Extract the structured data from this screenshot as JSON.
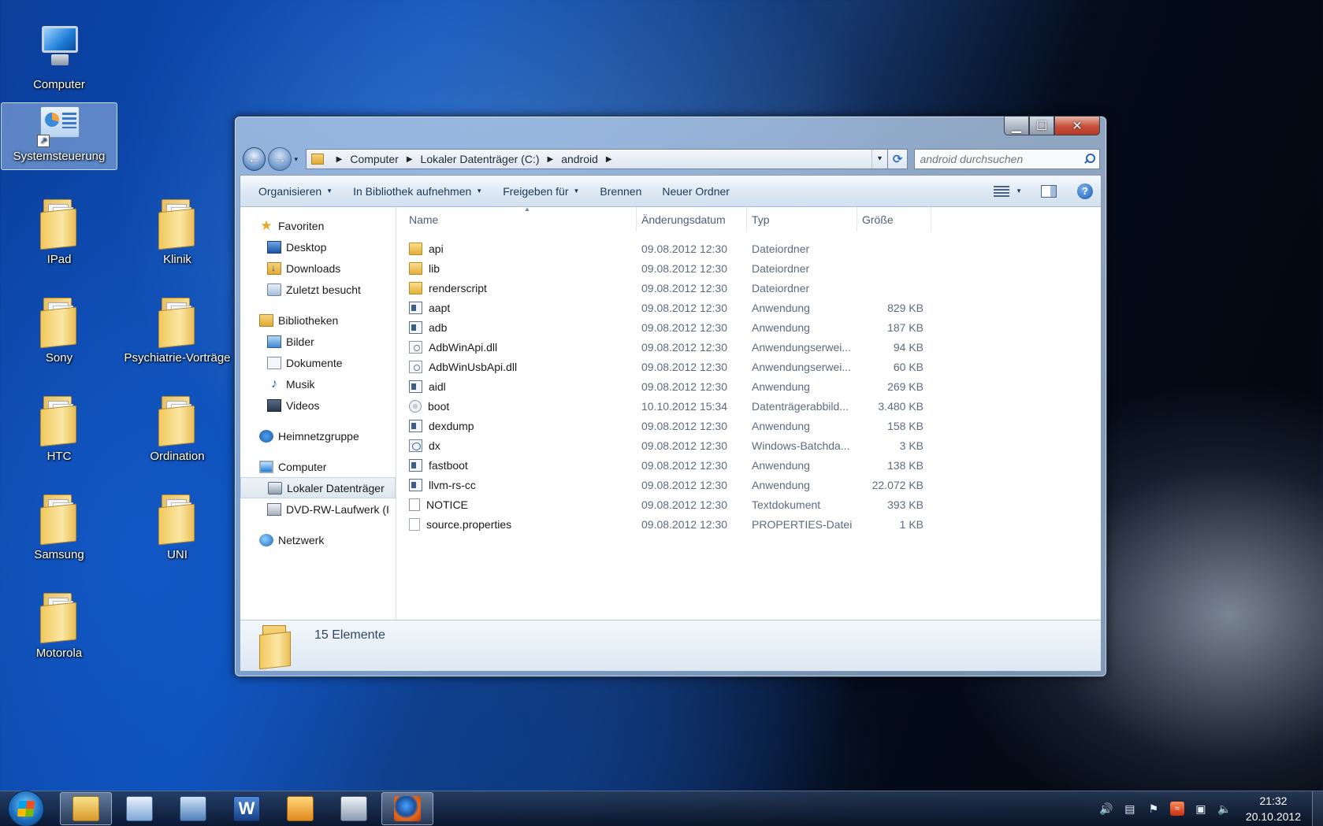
{
  "desktop": {
    "icons": [
      {
        "label": "Computer",
        "kind": "computer"
      },
      {
        "label": "Systemsteuerung",
        "kind": "control-panel"
      },
      {
        "label": "IPad",
        "kind": "folder"
      },
      {
        "label": "Klinik",
        "kind": "folder"
      },
      {
        "label": "Sony",
        "kind": "folder"
      },
      {
        "label": "Psychiatrie-Vorträge",
        "kind": "folder"
      },
      {
        "label": "HTC",
        "kind": "folder"
      },
      {
        "label": "Ordination",
        "kind": "folder"
      },
      {
        "label": "Samsung",
        "kind": "folder"
      },
      {
        "label": "UNI",
        "kind": "folder"
      },
      {
        "label": "Motorola",
        "kind": "folder"
      }
    ]
  },
  "window": {
    "caption_buttons": {
      "minimize": "▁",
      "maximize": "☐",
      "close": "✕"
    },
    "nav": {
      "back": "←",
      "forward": "→",
      "history": "▾"
    },
    "breadcrumb": [
      "Computer",
      "Lokaler Datenträger (C:)",
      "android"
    ],
    "breadcrumb_sep": "▶",
    "address_dropdown": "▾",
    "refresh": "⟳",
    "search": {
      "placeholder": "android durchsuchen",
      "value": ""
    },
    "toolbar": {
      "organize": "Organisieren",
      "add_to_library": "In Bibliothek aufnehmen",
      "share_with": "Freigeben für",
      "burn": "Brennen",
      "new_folder": "Neuer Ordner",
      "caret": "▼",
      "help": "?"
    },
    "nav_pane": {
      "favorites": "Favoriten",
      "desktop": "Desktop",
      "downloads": "Downloads",
      "recent": "Zuletzt besucht",
      "libraries": "Bibliotheken",
      "pictures": "Bilder",
      "documents": "Dokumente",
      "music": "Musik",
      "videos": "Videos",
      "homegroup": "Heimnetzgruppe",
      "computer": "Computer",
      "local_disk": "Lokaler Datenträger",
      "dvd": "DVD-RW-Laufwerk (I",
      "network": "Netzwerk"
    },
    "columns": {
      "name": "Name",
      "date": "Änderungsdatum",
      "type": "Typ",
      "size": "Größe",
      "sort_indicator": "▲"
    },
    "files": [
      {
        "name": "api",
        "date": "09.08.2012 12:30",
        "type": "Dateiordner",
        "size": "",
        "icon": "folder-icon"
      },
      {
        "name": "lib",
        "date": "09.08.2012 12:30",
        "type": "Dateiordner",
        "size": "",
        "icon": "folder-icon"
      },
      {
        "name": "renderscript",
        "date": "09.08.2012 12:30",
        "type": "Dateiordner",
        "size": "",
        "icon": "folder-icon"
      },
      {
        "name": "aapt",
        "date": "09.08.2012 12:30",
        "type": "Anwendung",
        "size": "829 KB",
        "icon": "application-icon"
      },
      {
        "name": "adb",
        "date": "09.08.2012 12:30",
        "type": "Anwendung",
        "size": "187 KB",
        "icon": "application-icon"
      },
      {
        "name": "AdbWinApi.dll",
        "date": "09.08.2012 12:30",
        "type": "Anwendungserwei...",
        "size": "94 KB",
        "icon": "dll-icon"
      },
      {
        "name": "AdbWinUsbApi.dll",
        "date": "09.08.2012 12:30",
        "type": "Anwendungserwei...",
        "size": "60 KB",
        "icon": "dll-icon"
      },
      {
        "name": "aidl",
        "date": "09.08.2012 12:30",
        "type": "Anwendung",
        "size": "269 KB",
        "icon": "application-icon"
      },
      {
        "name": "boot",
        "date": "10.10.2012 15:34",
        "type": "Datenträgerabbild...",
        "size": "3.480 KB",
        "icon": "disk-image-icon"
      },
      {
        "name": "dexdump",
        "date": "09.08.2012 12:30",
        "type": "Anwendung",
        "size": "158 KB",
        "icon": "application-icon"
      },
      {
        "name": "dx",
        "date": "09.08.2012 12:30",
        "type": "Windows-Batchda...",
        "size": "3 KB",
        "icon": "batch-file-icon"
      },
      {
        "name": "fastboot",
        "date": "09.08.2012 12:30",
        "type": "Anwendung",
        "size": "138 KB",
        "icon": "application-icon"
      },
      {
        "name": "llvm-rs-cc",
        "date": "09.08.2012 12:30",
        "type": "Anwendung",
        "size": "22.072 KB",
        "icon": "application-icon"
      },
      {
        "name": "NOTICE",
        "date": "09.08.2012 12:30",
        "type": "Textdokument",
        "size": "393 KB",
        "icon": "text-document-icon"
      },
      {
        "name": "source.properties",
        "date": "09.08.2012 12:30",
        "type": "PROPERTIES-Datei",
        "size": "1 KB",
        "icon": "properties-file-icon"
      }
    ],
    "details": {
      "count_text": "15 Elemente"
    }
  },
  "taskbar": {
    "apps": [
      "windows-explorer",
      "media-player",
      "paint",
      "word",
      "outlook",
      "keyboard-tool",
      "firefox"
    ],
    "word_glyph": "W",
    "tray": {
      "volume_glyph": "🔊",
      "flag_glyph": "⚑",
      "network_glyph": "▣",
      "sound_glyph": "🔈",
      "av_glyph": "≈",
      "kbd_glyph": "▤"
    },
    "time": "21:32",
    "date": "20.10.2012"
  }
}
